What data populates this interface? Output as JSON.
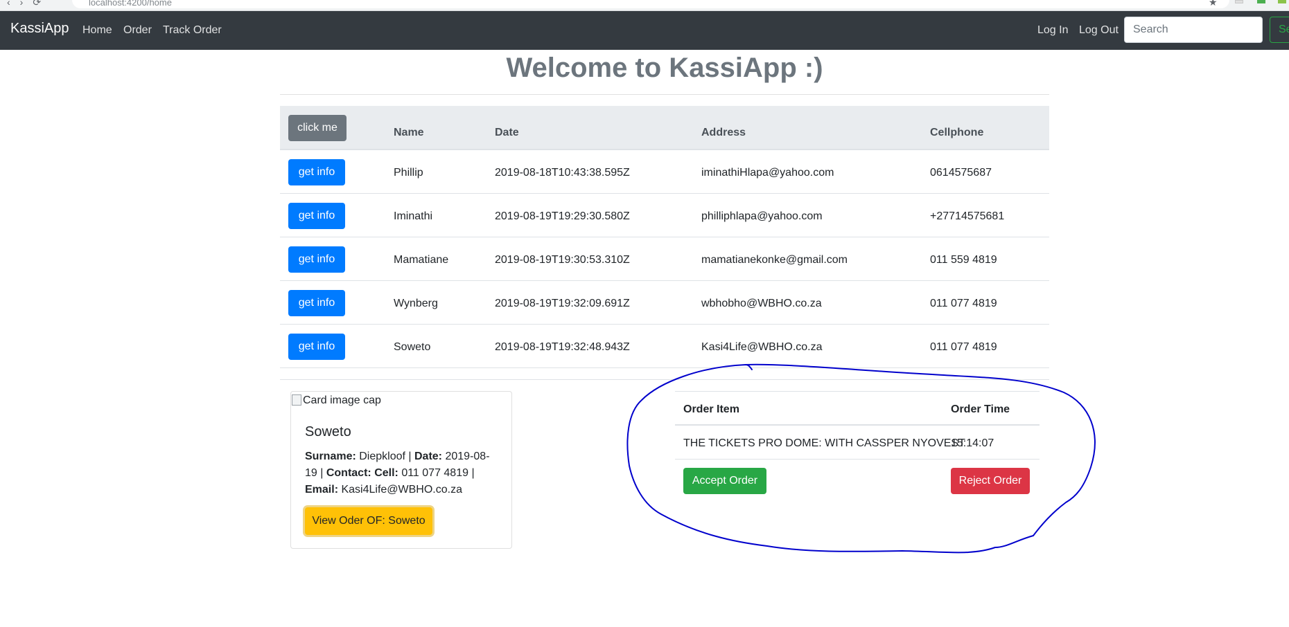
{
  "browser": {
    "url": "localhost:4200/home",
    "star_icon": "star-icon"
  },
  "navbar": {
    "brand": "KassiApp",
    "links": [
      "Home",
      "Order",
      "Track Order"
    ],
    "login": "Log In",
    "logout": "Log Out",
    "search_placeholder": "Search",
    "search_button": "Search"
  },
  "main": {
    "title": "Welcome to KassiApp :)",
    "table": {
      "header_button": "click me",
      "columns": [
        "Name",
        "Date",
        "Address",
        "Cellphone"
      ],
      "row_button": "get info",
      "rows": [
        {
          "name": "Phillip",
          "date": "2019-08-18T10:43:38.595Z",
          "address": "iminathiHlapa@yahoo.com",
          "cell": "0614575687"
        },
        {
          "name": "Iminathi",
          "date": "2019-08-19T19:29:30.580Z",
          "address": "philliphlapa@yahoo.com",
          "cell": "+27714575681"
        },
        {
          "name": "Mamatiane",
          "date": "2019-08-19T19:30:53.310Z",
          "address": "mamatianekonke@gmail.com",
          "cell": "011 559 4819"
        },
        {
          "name": "Wynberg",
          "date": "2019-08-19T19:32:09.691Z",
          "address": "wbhobho@WBHO.co.za",
          "cell": "011 077 4819"
        },
        {
          "name": "Soweto",
          "date": "2019-08-19T19:32:48.943Z",
          "address": "Kasi4Life@WBHO.co.za",
          "cell": "011 077 4819"
        }
      ]
    }
  },
  "card": {
    "image_alt": "Card image cap",
    "title": "Soweto",
    "surname_label": "Surname:",
    "surname": "Diepkloof",
    "date_label": "Date:",
    "date": "2019-08-19",
    "contact_label": "Contact:",
    "cell_label": "Cell:",
    "cell": "011 077 4819",
    "email_label": "Email:",
    "email": "Kasi4Life@WBHO.co.za",
    "button": "View Oder OF: Soweto"
  },
  "order": {
    "columns": [
      "Order Item",
      "Order Time"
    ],
    "item": "THE TICKETS PRO DOME: WITH CASSPER NYOVEST",
    "time": "15:14:07",
    "accept": "Accept Order",
    "reject": "Reject Order"
  },
  "colors": {
    "navbar_bg": "#343a40",
    "primary": "#007bff",
    "secondary": "#6c757d",
    "success": "#28a745",
    "danger": "#dc3545",
    "warning": "#ffc107",
    "annotation_ink": "#0000cc"
  }
}
